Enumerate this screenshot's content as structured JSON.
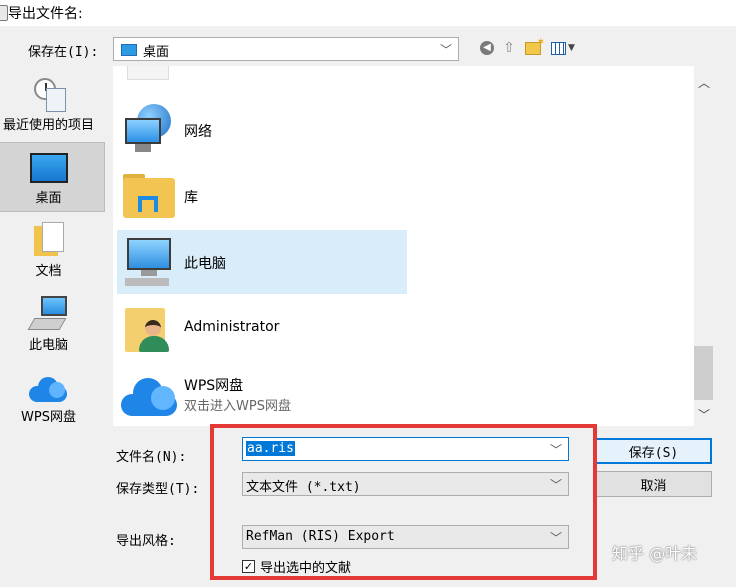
{
  "window": {
    "title": "导出文件名:"
  },
  "location": {
    "label": "保存在(I):",
    "value": "桌面"
  },
  "sidebar": {
    "items": [
      {
        "label": "最近使用的项目",
        "icon": "recent-items-icon"
      },
      {
        "label": "桌面",
        "icon": "desktop-icon",
        "selected": true
      },
      {
        "label": "文档",
        "icon": "documents-icon"
      },
      {
        "label": "此电脑",
        "icon": "computer-icon"
      },
      {
        "label": "WPS网盘",
        "icon": "cloud-icon"
      }
    ]
  },
  "files": {
    "items": [
      {
        "name": "网络",
        "icon": "network-icon"
      },
      {
        "name": "库",
        "icon": "library-icon"
      },
      {
        "name": "此电脑",
        "icon": "computer-icon",
        "selected": true
      },
      {
        "name": "Administrator",
        "icon": "user-folder-icon"
      },
      {
        "name": "WPS网盘",
        "subtitle": "双击进入WPS网盘",
        "icon": "cloud-icon"
      }
    ]
  },
  "form": {
    "filename_label": "文件名(N):",
    "filename_value": "aa.ris",
    "filetype_label": "保存类型(T):",
    "filetype_value": "文本文件 (*.txt)",
    "style_label": "导出风格:",
    "style_value": "RefMan (RIS) Export",
    "checkbox_label": "导出选中的文献",
    "checkbox_checked": true,
    "save_label": "保存(S)",
    "cancel_label": "取消"
  },
  "watermark": "知乎 @叶未",
  "colors": {
    "accent": "#0078d7",
    "highlight_box": "#e53935",
    "selection": "#d9ecf9"
  }
}
